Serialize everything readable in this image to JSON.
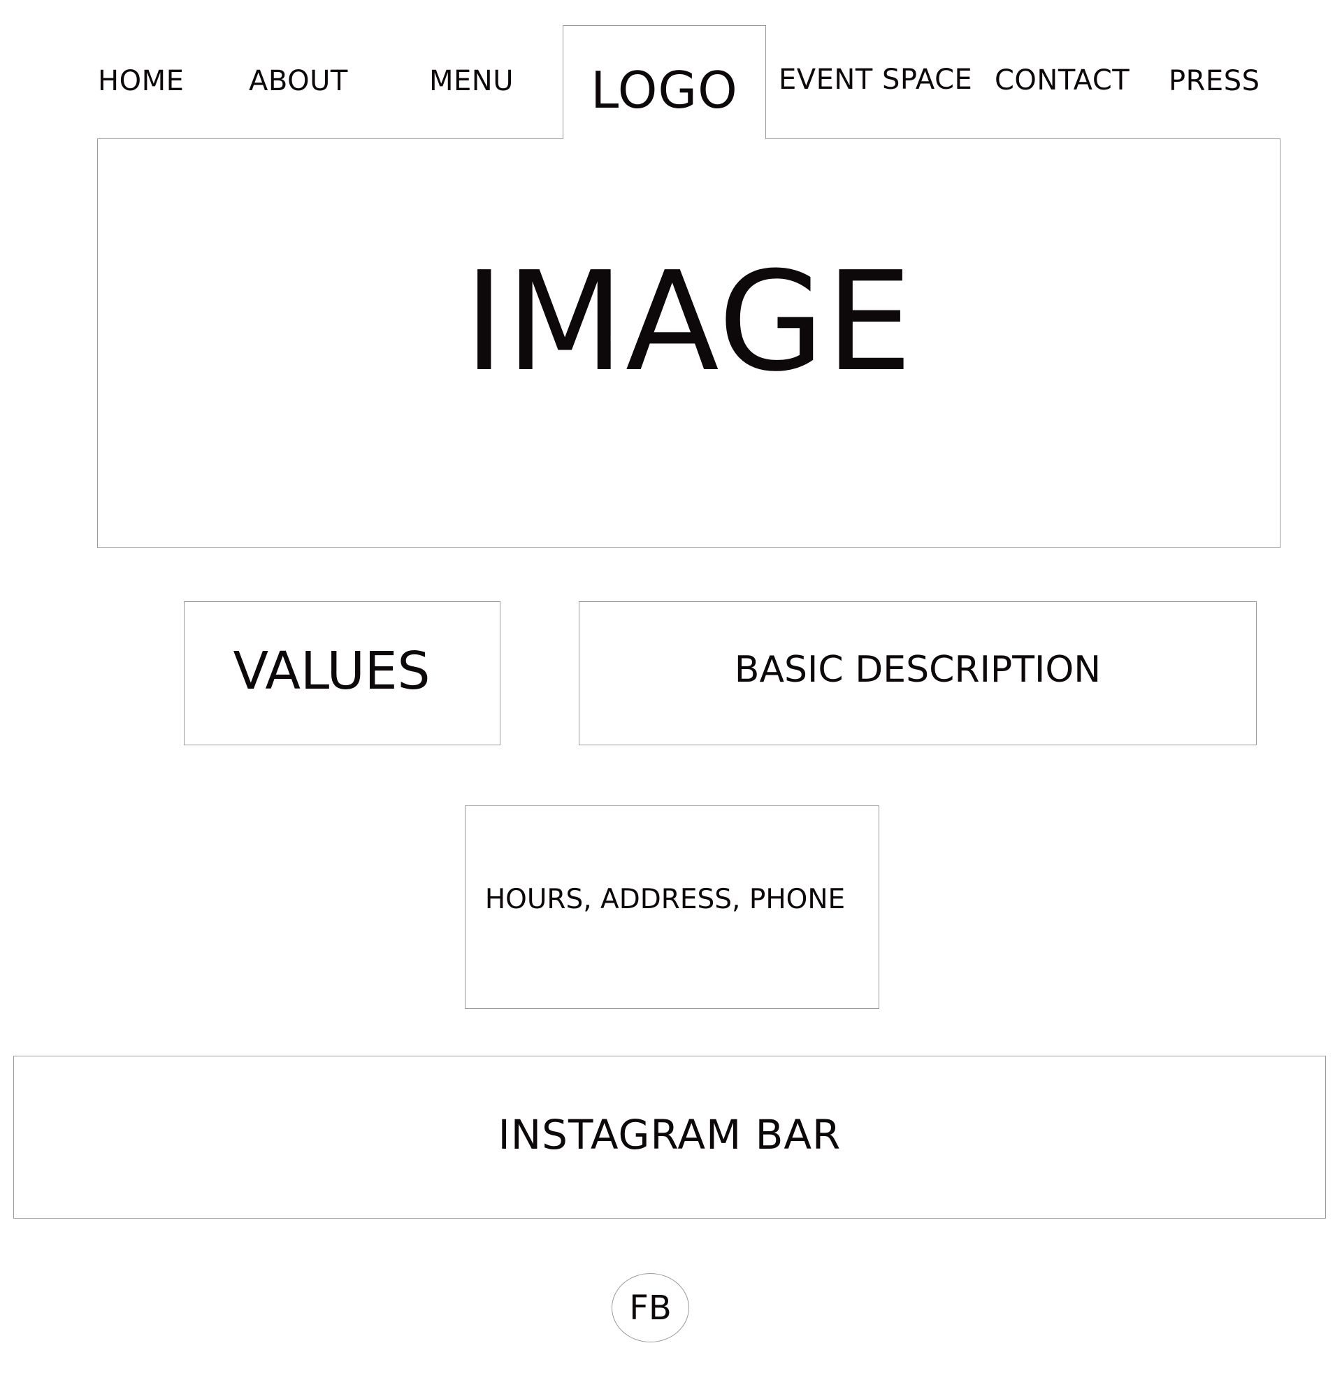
{
  "nav": {
    "home": "HOME",
    "about": "ABOUT",
    "menu": "MENU",
    "logo": "LOGO",
    "event_space": "EVENT SPACE",
    "contact": "CONTACT",
    "press": "PRESS"
  },
  "hero": {
    "label": "IMAGE"
  },
  "sections": {
    "values": "VALUES",
    "basic_description": "BASIC DESCRIPTION",
    "info": "HOURS, ADDRESS, PHONE"
  },
  "instagram": {
    "label": "INSTAGRAM BAR"
  },
  "social": {
    "facebook": "FB"
  },
  "colors": {
    "text": "#0d0809",
    "border": "#9a9a9a",
    "background": "#ffffff"
  }
}
